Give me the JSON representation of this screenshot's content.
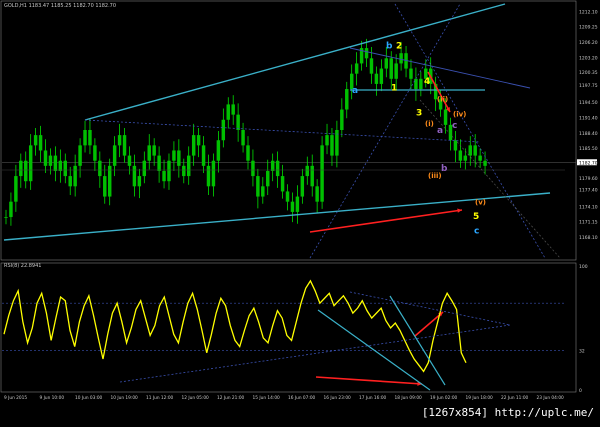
{
  "header": {
    "symbol_line": "GOLD,H1  1183.47 1185.25 1182.70 1182.70"
  },
  "rsi_header": {
    "label": "RSI(8) 22.8941"
  },
  "watermark": "[1267x854] http://uplc.me/",
  "colors": {
    "background": "#000000",
    "candle_body": "#00c000",
    "candle_wick": "#00ff00",
    "channel_line": "#3ab0c8",
    "dotted_line": "#3a50b0",
    "rsi_line": "#ffff00",
    "arrow": "#ff2020",
    "wave_cyan": "#2aa6ff",
    "wave_yellow": "#ffff00",
    "wave_orange": "#ff8c1a",
    "wave_purple": "#9060c0"
  },
  "chart_data": [
    {
      "type": "candlestick",
      "title": "GOLD,H1",
      "ylim": [
        1164,
        1214
      ],
      "y_ticks": [
        "1212.10",
        "1209.25",
        "1206.20",
        "1203.20",
        "1200.35",
        "1197.75",
        "1194.50",
        "1191.40",
        "1188.40",
        "1185.50",
        "1182.70",
        "1179.60",
        "1177.40",
        "1174.10",
        "1171.15",
        "1168.10"
      ],
      "current_price": "1182.70",
      "x_ticks": [
        "9 Jun 2015",
        "9 Jun 10:00",
        "10 Jun 03:00",
        "10 Jun 19:00",
        "11 Jun 12:00",
        "12 Jun 05:00",
        "12 Jun 21:00",
        "15 Jun 14:00",
        "16 Jun 07:00",
        "16 Jun 23:00",
        "17 Jun 16:00",
        "18 Jun 09:00",
        "19 Jun 02:00",
        "19 Jun 18:00",
        "22 Jun 11:00",
        "23 Jun 04:00"
      ],
      "close_path": [
        1172,
        1175,
        1180,
        1183,
        1179,
        1186,
        1188,
        1185,
        1182,
        1184,
        1181,
        1183,
        1180,
        1178,
        1182,
        1186,
        1189,
        1186,
        1183,
        1180,
        1176,
        1182,
        1186,
        1188,
        1184,
        1182,
        1178,
        1180,
        1183,
        1186,
        1184,
        1181,
        1179,
        1183,
        1185,
        1182,
        1180,
        1184,
        1188,
        1186,
        1182,
        1178,
        1183,
        1187,
        1191,
        1194,
        1192,
        1189,
        1186,
        1183,
        1180,
        1176,
        1178,
        1181,
        1183,
        1180,
        1177,
        1175,
        1173,
        1176,
        1180,
        1182,
        1178,
        1175,
        1186,
        1188,
        1184,
        1189,
        1193,
        1197,
        1200,
        1202,
        1205,
        1203,
        1200,
        1198,
        1201,
        1203,
        1199,
        1202,
        1204,
        1201,
        1199,
        1197,
        1199,
        1201,
        1198,
        1195,
        1193,
        1190,
        1187,
        1185,
        1183,
        1184,
        1186,
        1184,
        1183,
        1182
      ],
      "wave_labels": [
        {
          "text": "a",
          "color": "cyan",
          "price": 1196.8
        },
        {
          "text": "b",
          "color": "cyan",
          "price": 1205.5
        },
        {
          "text": "2",
          "color": "yellow",
          "price": 1205.5
        },
        {
          "text": "1",
          "color": "yellow",
          "price": 1197.3
        },
        {
          "text": "4",
          "color": "yellow",
          "price": 1198.6
        },
        {
          "text": "3",
          "color": "yellow",
          "price": 1192.4
        },
        {
          "text": "(ii)",
          "color": "orange",
          "price": 1195.2
        },
        {
          "text": "(iv)",
          "color": "orange",
          "price": 1192.2
        },
        {
          "text": "(i)",
          "color": "orange",
          "price": 1190.4
        },
        {
          "text": "c",
          "color": "purple",
          "price": 1190.0
        },
        {
          "text": "a",
          "color": "purple",
          "price": 1189.0
        },
        {
          "text": "b",
          "color": "purple",
          "price": 1181.6
        },
        {
          "text": "(iii)",
          "color": "orange",
          "price": 1180.2
        },
        {
          "text": "(v)",
          "color": "orange",
          "price": 1175.0
        },
        {
          "text": "5",
          "color": "yellow",
          "price": 1172.2
        },
        {
          "text": "c",
          "color": "cyan",
          "price": 1169.4
        }
      ]
    },
    {
      "type": "line",
      "title": "RSI(8)",
      "value_label": "22.8941",
      "ylim": [
        0,
        100
      ],
      "y_ticks": [
        "100",
        "32",
        "0"
      ],
      "values": [
        45,
        60,
        72,
        80,
        55,
        38,
        50,
        70,
        78,
        62,
        40,
        58,
        75,
        72,
        48,
        35,
        55,
        68,
        76,
        60,
        42,
        25,
        45,
        62,
        70,
        55,
        38,
        50,
        65,
        72,
        58,
        44,
        52,
        68,
        75,
        60,
        45,
        38,
        55,
        70,
        78,
        65,
        48,
        30,
        45,
        62,
        74,
        68,
        52,
        40,
        35,
        48,
        60,
        66,
        55,
        42,
        38,
        52,
        64,
        58,
        44,
        40,
        55,
        70,
        82,
        88,
        80,
        70,
        74,
        78,
        68,
        72,
        76,
        70,
        62,
        66,
        72,
        64,
        58,
        62,
        66,
        56,
        50,
        54,
        48,
        40,
        32,
        25,
        20,
        15,
        22,
        40,
        55,
        70,
        78,
        72,
        65,
        30,
        22
      ]
    }
  ]
}
